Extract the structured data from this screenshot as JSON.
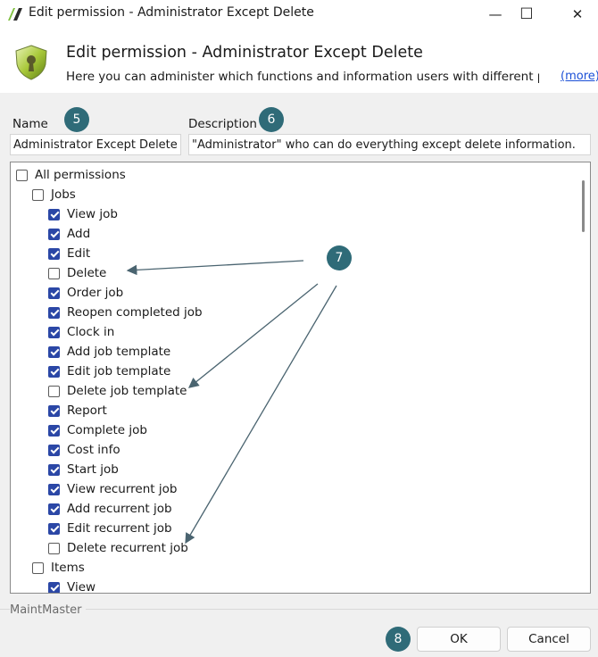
{
  "window": {
    "title": "Edit permission - Administrator Except Delete",
    "minimize_glyph": "—",
    "maximize_glyph": "☐",
    "close_glyph": "✕"
  },
  "header": {
    "title": "Edit permission - Administrator Except Delete",
    "description": "Here you can administer which functions and information users with different per...",
    "more_link": "(more)",
    "icon": "shield-icon"
  },
  "form": {
    "name_label": "Name",
    "name_value": "Administrator Except Delete",
    "description_label": "Description",
    "description_value": "\"Administrator\" who can do everything except delete information."
  },
  "callouts": {
    "c5": "5",
    "c6": "6",
    "c7": "7",
    "c8": "8"
  },
  "tree": {
    "items": [
      {
        "label": "All permissions",
        "checked": false,
        "level": 0
      },
      {
        "label": "Jobs",
        "checked": false,
        "level": 1
      },
      {
        "label": "View job",
        "checked": true,
        "level": 2
      },
      {
        "label": "Add",
        "checked": true,
        "level": 2
      },
      {
        "label": "Edit",
        "checked": true,
        "level": 2
      },
      {
        "label": "Delete",
        "checked": false,
        "level": 2
      },
      {
        "label": "Order job",
        "checked": true,
        "level": 2
      },
      {
        "label": "Reopen completed job",
        "checked": true,
        "level": 2
      },
      {
        "label": "Clock in",
        "checked": true,
        "level": 2
      },
      {
        "label": "Add job template",
        "checked": true,
        "level": 2
      },
      {
        "label": "Edit job template",
        "checked": true,
        "level": 2
      },
      {
        "label": "Delete job template",
        "checked": false,
        "level": 2
      },
      {
        "label": "Report",
        "checked": true,
        "level": 2
      },
      {
        "label": "Complete job",
        "checked": true,
        "level": 2
      },
      {
        "label": "Cost info",
        "checked": true,
        "level": 2
      },
      {
        "label": "Start job",
        "checked": true,
        "level": 2
      },
      {
        "label": "View recurrent job",
        "checked": true,
        "level": 2
      },
      {
        "label": "Add recurrent job",
        "checked": true,
        "level": 2
      },
      {
        "label": "Edit recurrent job",
        "checked": true,
        "level": 2
      },
      {
        "label": "Delete recurrent job",
        "checked": false,
        "level": 2
      },
      {
        "label": "Items",
        "checked": false,
        "level": 1
      },
      {
        "label": "View",
        "checked": true,
        "level": 2
      }
    ]
  },
  "footer": {
    "brand": "MaintMaster",
    "ok_label": "OK",
    "cancel_label": "Cancel"
  },
  "colors": {
    "callout": "#2f6b78",
    "checkbox_checked": "#2b47a6",
    "link": "#1a4fd6",
    "arrow": "#4a6470"
  }
}
